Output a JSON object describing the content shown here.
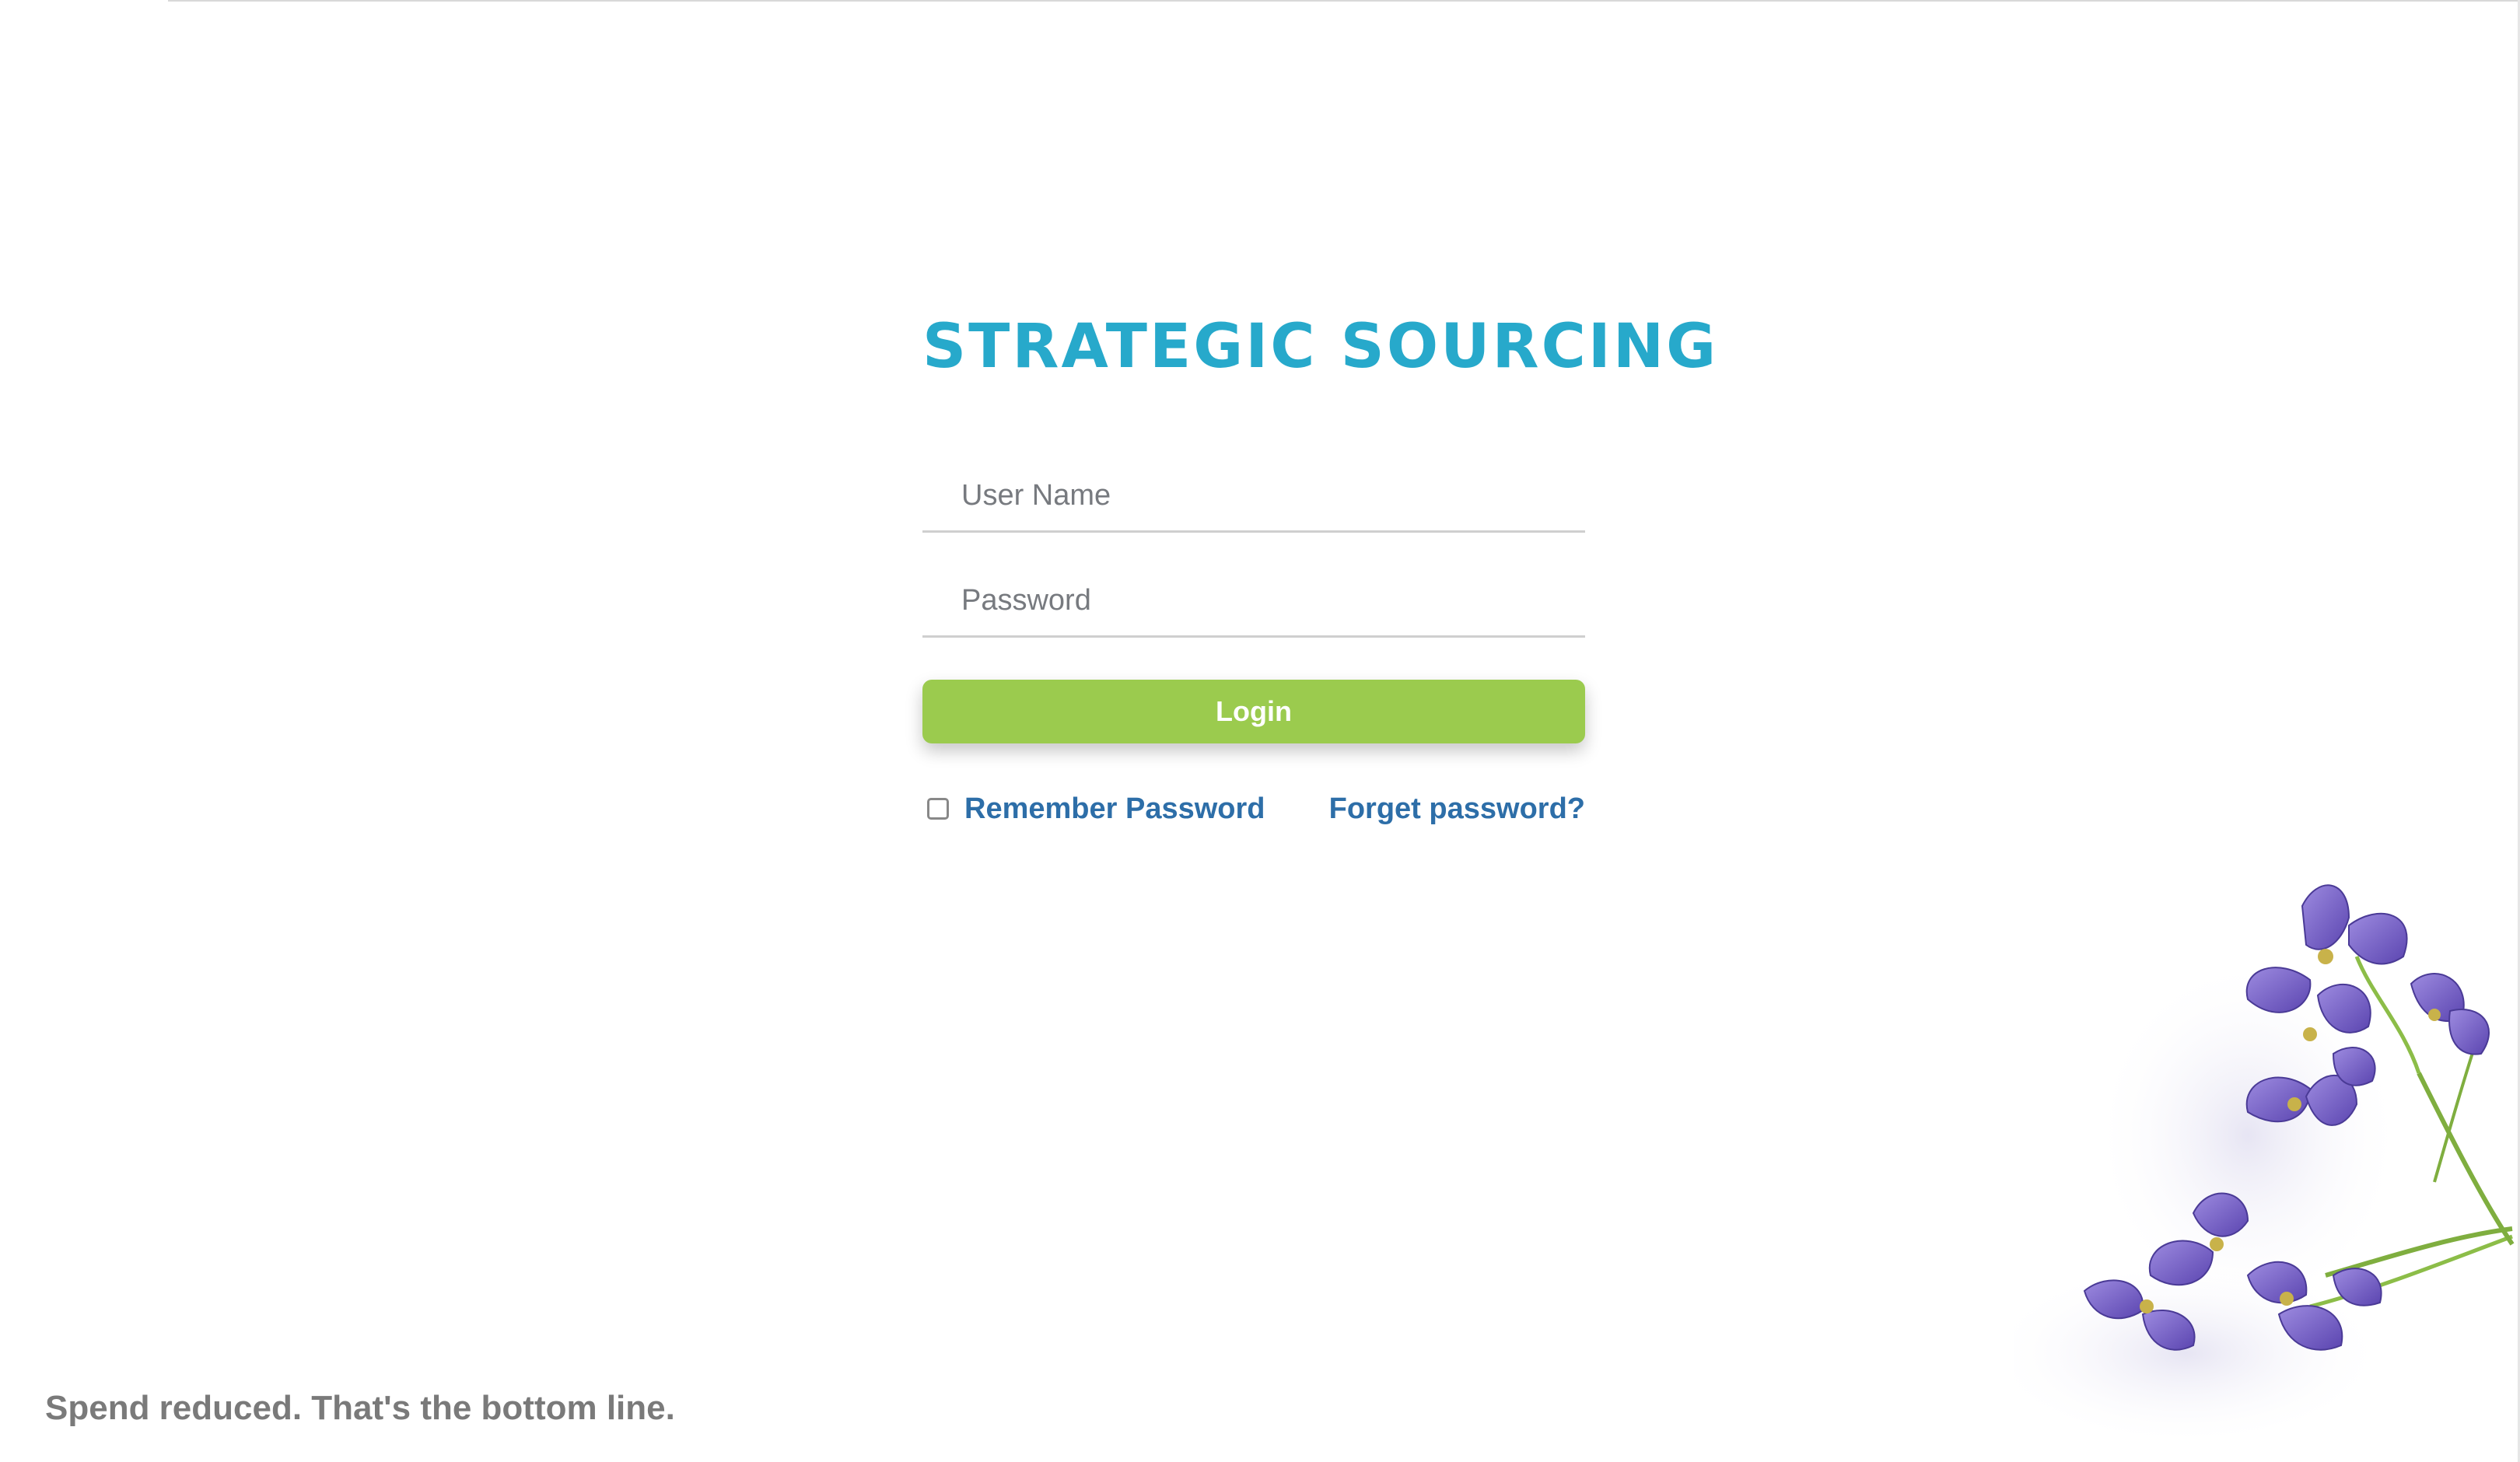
{
  "brand": {
    "title": "STRATEGIC SOURCING",
    "color": "#27a9cb"
  },
  "form": {
    "username_placeholder": "User Name",
    "password_placeholder": "Password",
    "login_label": "Login",
    "remember_label": "Remember Password",
    "remember_checked": false,
    "forgot_label": "Forget password?"
  },
  "footer": {
    "tagline": "Spend reduced. That's the bottom line."
  },
  "decoration": {
    "image": "purple-iris-flowers"
  },
  "colors": {
    "button": "#9bcb4e",
    "link": "#2d6ea8",
    "tagline": "#7a7a7a",
    "flower": "#7b63c9"
  }
}
